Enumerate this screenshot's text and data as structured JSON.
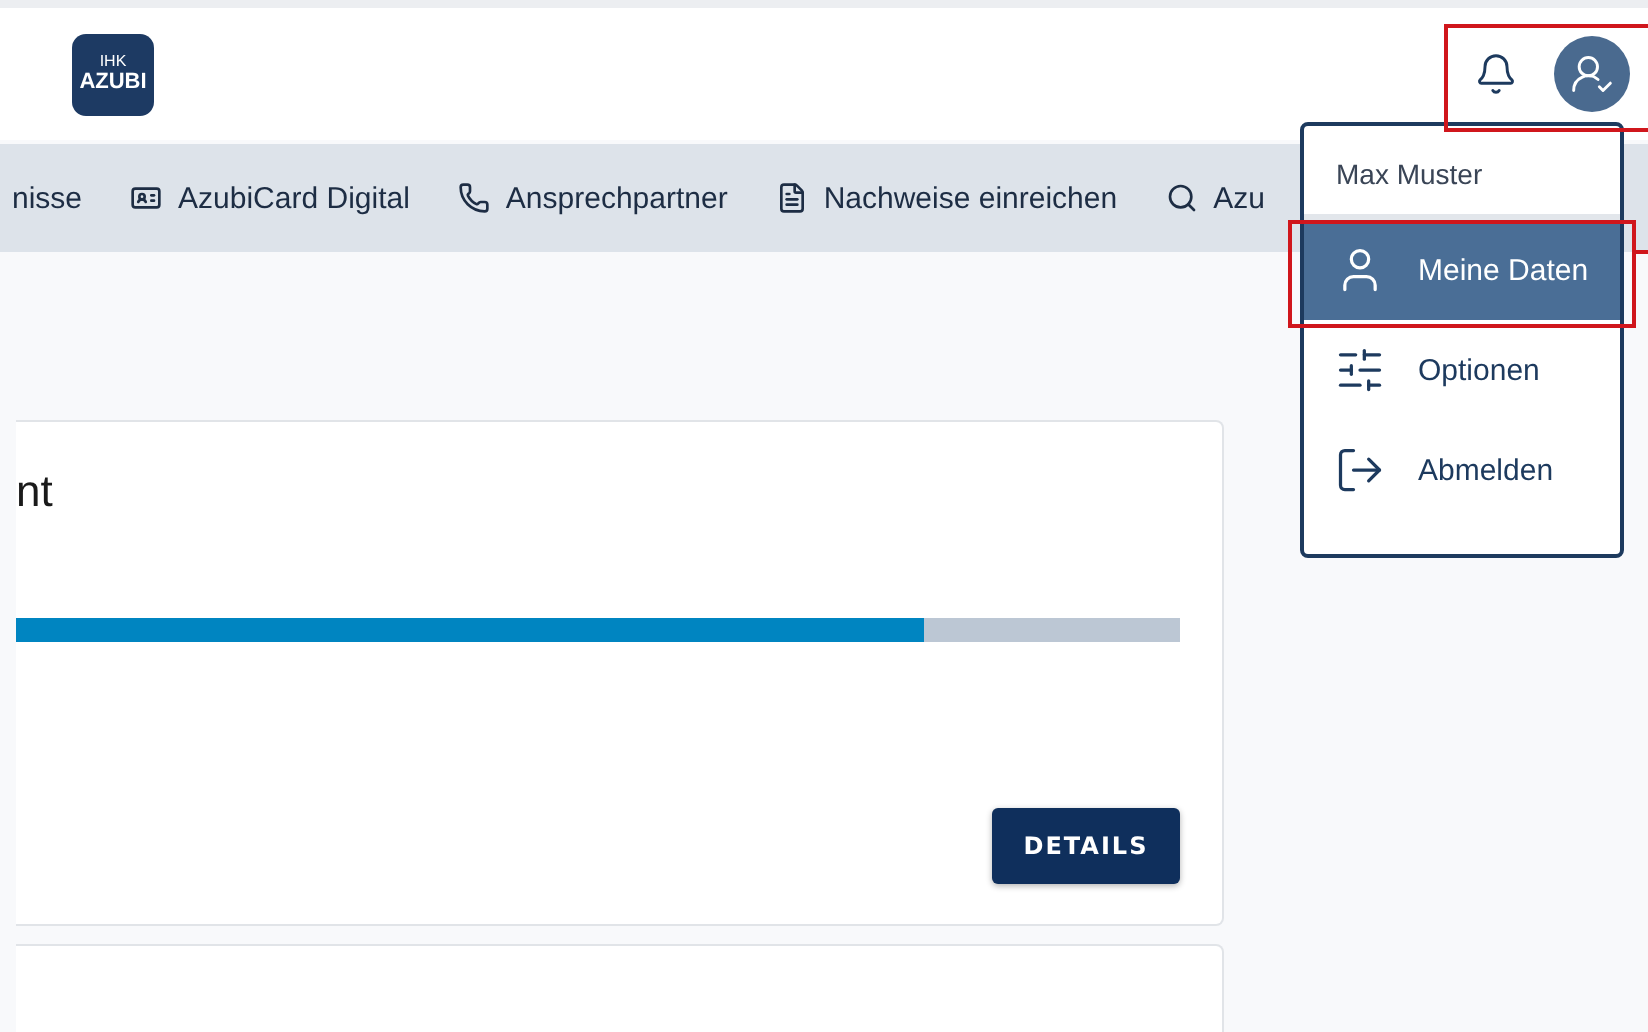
{
  "header": {
    "logo": {
      "top": "IHK",
      "bottom": "AZUBI"
    }
  },
  "nav": [
    {
      "label": "nisse",
      "kind": "text"
    },
    {
      "label": "AzubiCard Digital",
      "kind": "card"
    },
    {
      "label": "Ansprechpartner",
      "kind": "phone"
    },
    {
      "label": "Nachweise einreichen",
      "kind": "file"
    },
    {
      "label": "Azu",
      "kind": "search"
    }
  ],
  "user_menu": {
    "name": "Max Muster",
    "items": [
      {
        "label": "Meine Daten",
        "kind": "user",
        "selected": true
      },
      {
        "label": "Optionen",
        "kind": "options",
        "selected": false
      },
      {
        "label": "Abmelden",
        "kind": "logout",
        "selected": false
      }
    ]
  },
  "card": {
    "title": "nt",
    "progress": {
      "level": 0.78
    },
    "button": "DETAILS"
  }
}
